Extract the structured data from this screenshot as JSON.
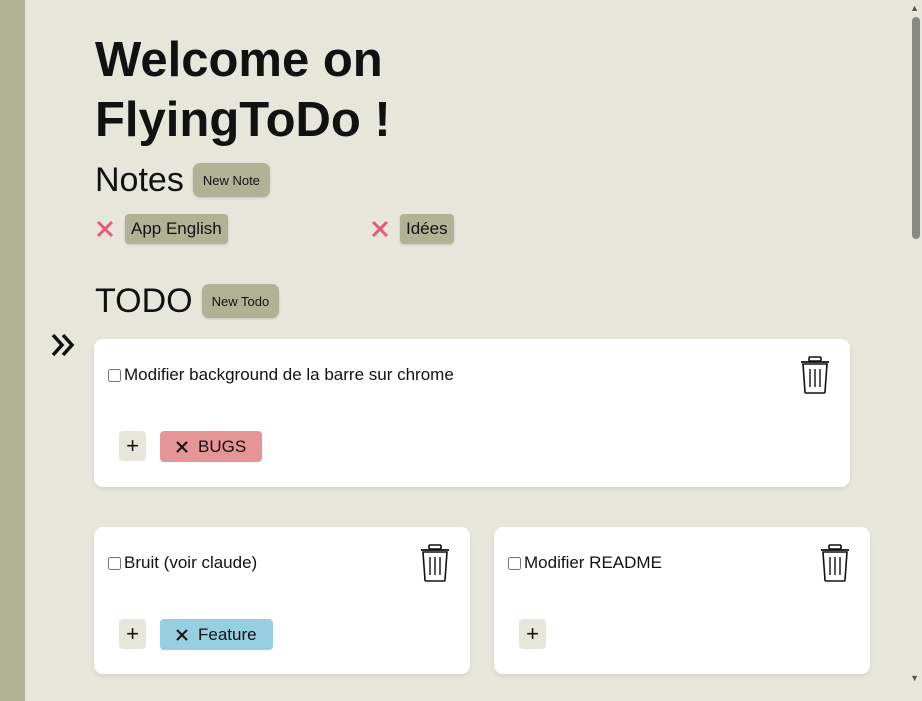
{
  "header": {
    "title": "Welcome on FlyingToDo !"
  },
  "notes": {
    "heading": "Notes",
    "new_button": "New Note",
    "items": [
      {
        "label": "App English"
      },
      {
        "label": "Idées"
      }
    ]
  },
  "todo": {
    "heading": "TODO",
    "new_button": "New Todo",
    "items": [
      {
        "text": "Modifier background de la barre sur chrome",
        "checked": false,
        "tags": [
          {
            "label": "BUGS",
            "color": "#e59595"
          }
        ]
      },
      {
        "text": "Bruit (voir claude)",
        "checked": false,
        "tags": [
          {
            "label": "Feature",
            "color": "#96cfdf"
          }
        ]
      },
      {
        "text": "Modifier README",
        "checked": false,
        "tags": []
      }
    ],
    "add_tag_label": "+"
  },
  "colors": {
    "accent": "#b1b295",
    "background": "#e6e6da",
    "delete_x": "#e65a78"
  },
  "icons": {
    "collapse": "double-chevron-right-icon",
    "delete": "trash-icon",
    "remove": "close-icon"
  }
}
